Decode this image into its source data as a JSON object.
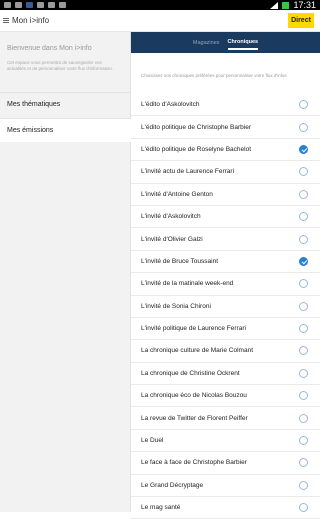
{
  "statusbar": {
    "time": "17:31"
  },
  "appbar": {
    "title": "Mon i>info",
    "direct_label": "Direct"
  },
  "sidebar": {
    "welcome_title": "Bienvenue dans Mon i>info",
    "welcome_desc": "Cet espace vous permettra de sauvegarder vos actualités et de personnaliser votre flux d'information.",
    "items": [
      {
        "label": "Mes thématiques",
        "active": false
      },
      {
        "label": "Mes émissions",
        "active": true
      }
    ]
  },
  "tabs": [
    {
      "label": "Magazines",
      "active": false
    },
    {
      "label": "Chroniques",
      "active": true
    }
  ],
  "list_intro": "Choisissez vos chroniques préférées pour personnaliser votre flux d'infos",
  "chroniques": [
    {
      "label": "L'édito d'Askolovitch",
      "checked": false
    },
    {
      "label": "L'édito politique de Christophe Barbier",
      "checked": false
    },
    {
      "label": "L'édito politique de Roselyne Bachelot",
      "checked": true
    },
    {
      "label": "L'invité actu de Laurence Ferrari",
      "checked": false
    },
    {
      "label": "L'invité d'Antoine Genton",
      "checked": false
    },
    {
      "label": "L'invité d'Askolovitch",
      "checked": false
    },
    {
      "label": "L'invité d'Olivier Galzi",
      "checked": false
    },
    {
      "label": "L'invité de Bruce Toussaint",
      "checked": true
    },
    {
      "label": "L'invité de la matinale week-end",
      "checked": false
    },
    {
      "label": "L'invité de Sonia Chironi",
      "checked": false
    },
    {
      "label": "L'invité politique de Laurence Ferrari",
      "checked": false
    },
    {
      "label": "La chronique culture de Marie Colmant",
      "checked": false
    },
    {
      "label": "La chronique de Christine Ockrent",
      "checked": false
    },
    {
      "label": "La chronique éco de Nicolas Bouzou",
      "checked": false
    },
    {
      "label": "La revue de Twitter de Florent Peiffer",
      "checked": false
    },
    {
      "label": "Le Duel",
      "checked": false
    },
    {
      "label": "Le face à face de Christophe Barbier",
      "checked": false
    },
    {
      "label": "Le Grand Décryptage",
      "checked": false
    },
    {
      "label": "Le mag santé",
      "checked": false
    }
  ]
}
